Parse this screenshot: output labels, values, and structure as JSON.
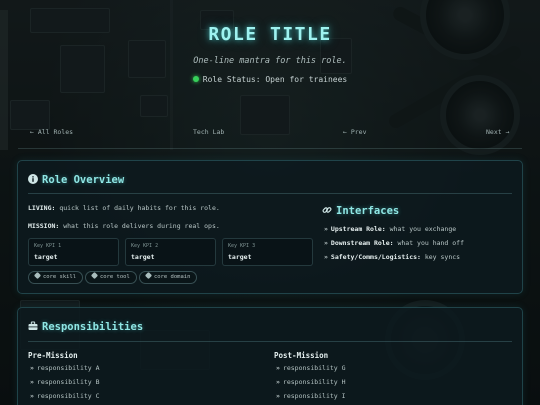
{
  "hero": {
    "title": "ROLE TITLE",
    "tagline": "One-line mantra for this role.",
    "status": "Role Status: Open for trainees",
    "status_color": "#37d05a"
  },
  "nav": {
    "all_roles": "← All Roles",
    "center": "Tech Lab",
    "prev": "← Prev",
    "next": "Next →"
  },
  "overview": {
    "title": "Role Overview",
    "living_label": "LIVING:",
    "living_text": "quick list of daily habits for this role.",
    "mission_label": "MISSION:",
    "mission_text": "what this role delivers during real ops.",
    "kpis": [
      {
        "label": "Key KPI 1",
        "value": "target"
      },
      {
        "label": "Key KPI 2",
        "value": "target"
      },
      {
        "label": "Key KPI 3",
        "value": "target"
      }
    ],
    "tags": [
      "core skill",
      "core tool",
      "core domain"
    ]
  },
  "interfaces": {
    "title": "Interfaces",
    "items": [
      {
        "label": "Upstream Role:",
        "text": "what you exchange"
      },
      {
        "label": "Downstream Role:",
        "text": "what you hand off"
      },
      {
        "label": "Safety/Comms/Logistics:",
        "text": "key syncs"
      }
    ]
  },
  "responsibilities": {
    "title": "Responsibilities",
    "pre_title": "Pre-Mission",
    "pre_items": [
      "responsibility A",
      "responsibility B",
      "responsibility C"
    ],
    "post_title": "Post-Mission",
    "post_items": [
      "responsibility G",
      "responsibility H",
      "responsibility I"
    ]
  },
  "colors": {
    "accent": "#8fe6e4",
    "title_glow": "#9ef2f0",
    "card_bg": "#0d1a1e"
  },
  "icons": [
    "info-icon",
    "link-icon",
    "briefcase-icon",
    "tag-icon",
    "arrow-icon"
  ]
}
